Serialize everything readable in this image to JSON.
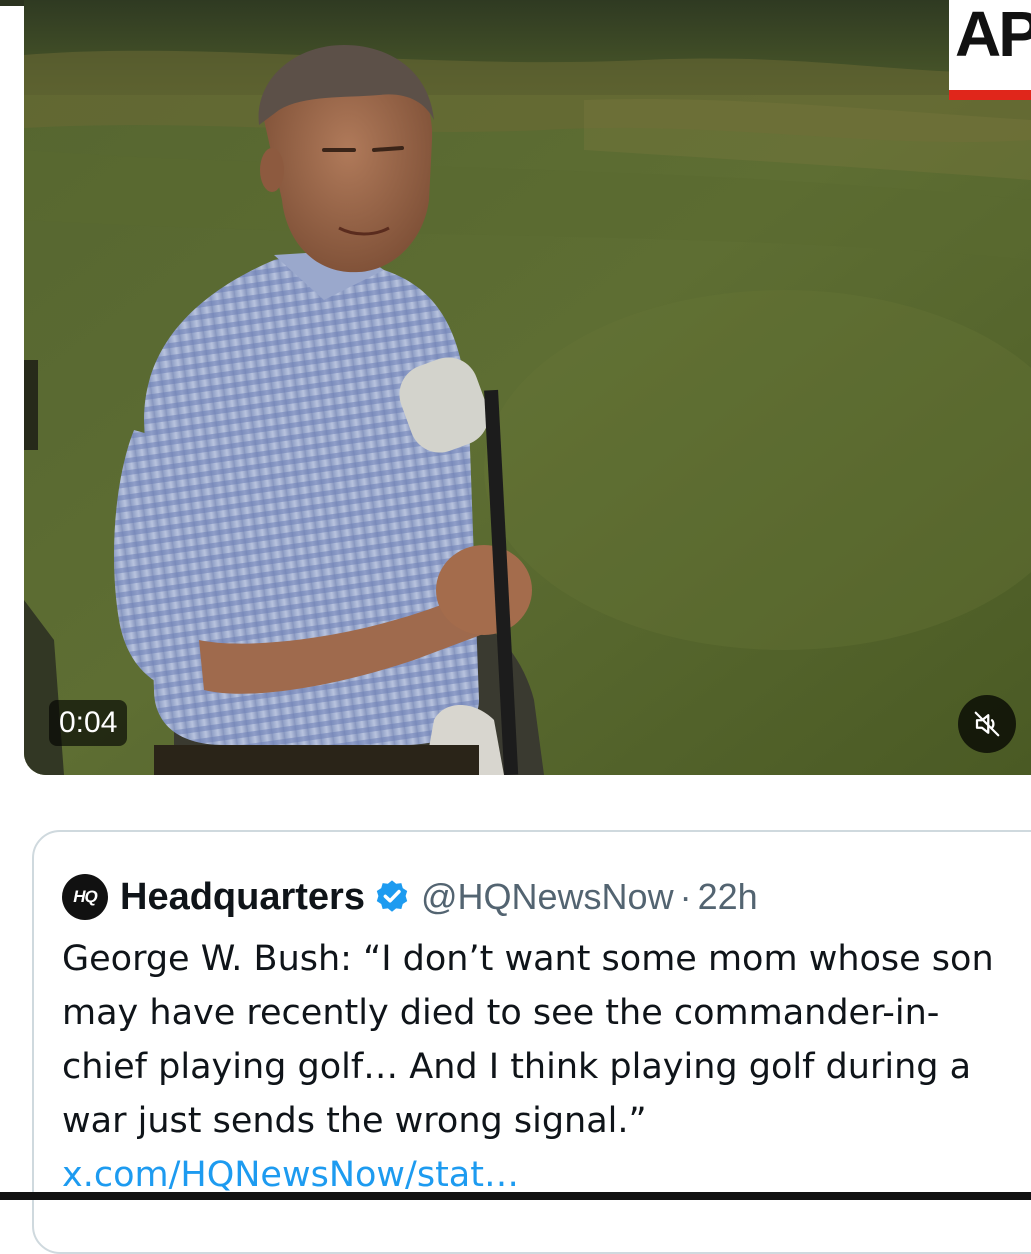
{
  "video": {
    "timestamp": "0:04",
    "corner_logo": "AP",
    "mute_icon": "speaker-muted-icon"
  },
  "quote_tweet": {
    "avatar_text": "HQ",
    "display_name": "Headquarters",
    "verified_icon": "verified-badge-icon",
    "verified_color": "#1d9bf0",
    "handle": "@HQNewsNow",
    "separator": "·",
    "time": "22h",
    "text": "George W. Bush: “I don’t want some mom whose son may have recently died to see the commander-in-chief playing golf… And I think playing golf during a war just sends the wrong signal.”",
    "link": "x.com/HQNewsNow/stat…"
  },
  "colors": {
    "link": "#1d9bf0",
    "text": "#0f1419",
    "secondary_text": "#536471",
    "card_border": "#cfd9de",
    "logo_bar": "#e0261b"
  }
}
